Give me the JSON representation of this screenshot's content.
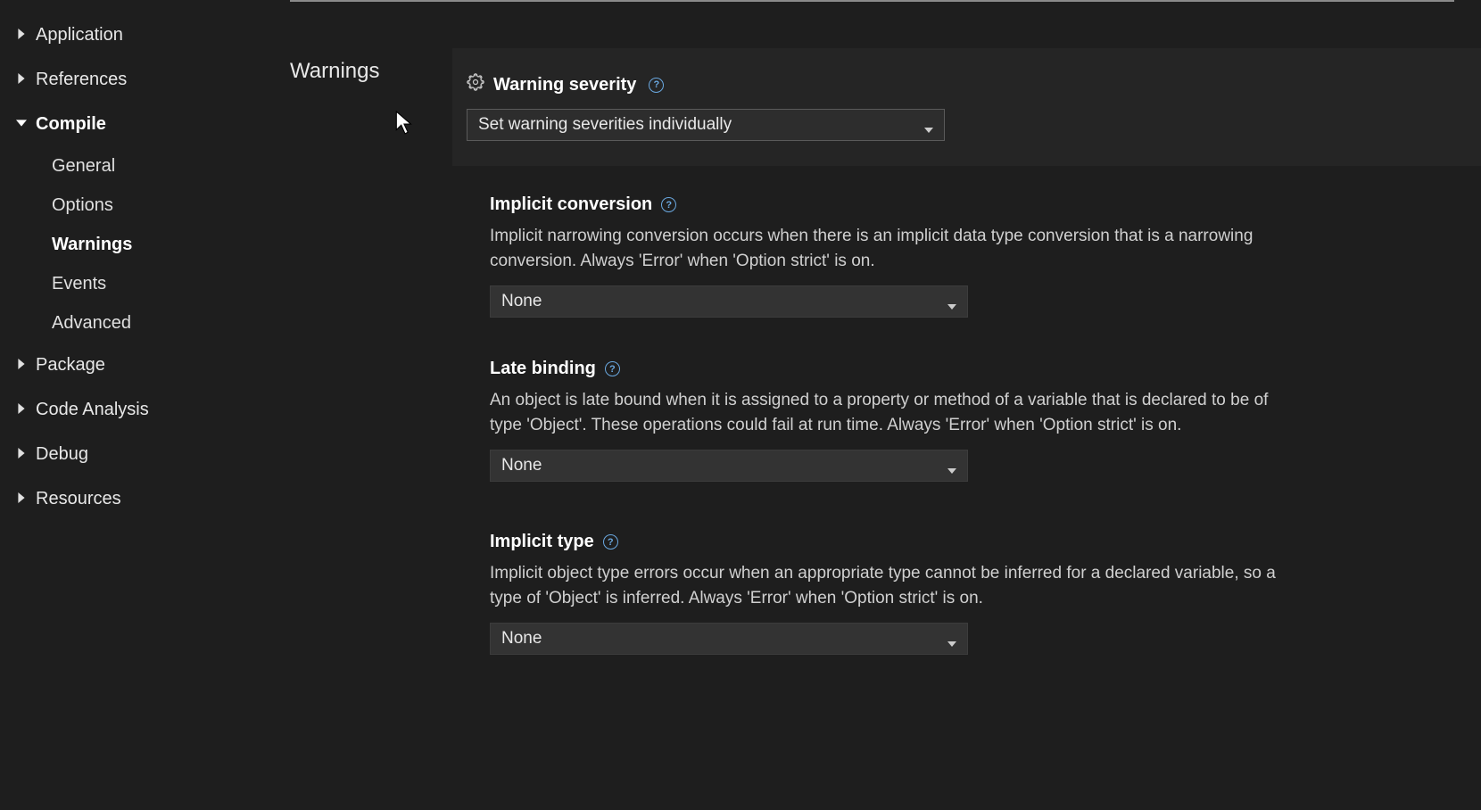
{
  "sidebar": {
    "items": [
      {
        "label": "Application",
        "expanded": false
      },
      {
        "label": "References",
        "expanded": false
      },
      {
        "label": "Compile",
        "expanded": true,
        "children": [
          {
            "label": "General"
          },
          {
            "label": "Options"
          },
          {
            "label": "Warnings",
            "active": true
          },
          {
            "label": "Events"
          },
          {
            "label": "Advanced"
          }
        ]
      },
      {
        "label": "Package",
        "expanded": false
      },
      {
        "label": "Code Analysis",
        "expanded": false
      },
      {
        "label": "Debug",
        "expanded": false
      },
      {
        "label": "Resources",
        "expanded": false
      }
    ]
  },
  "section_title": "Warnings",
  "warning_severity": {
    "label": "Warning severity",
    "selected": "Set warning severities individually"
  },
  "settings": [
    {
      "title": "Implicit conversion",
      "description": "Implicit narrowing conversion occurs when there is an implicit data type conversion that is a narrowing conversion. Always 'Error' when 'Option strict' is on.",
      "value": "None"
    },
    {
      "title": "Late binding",
      "description": "An object is late bound when it is assigned to a property or method of a variable that is declared to be of type 'Object'. These operations could fail at run time. Always 'Error' when 'Option strict' is on.",
      "value": "None"
    },
    {
      "title": "Implicit type",
      "description": "Implicit object type errors occur when an appropriate type cannot be inferred for a declared variable, so a type of 'Object' is inferred. Always 'Error' when 'Option strict' is on.",
      "value": "None"
    }
  ]
}
